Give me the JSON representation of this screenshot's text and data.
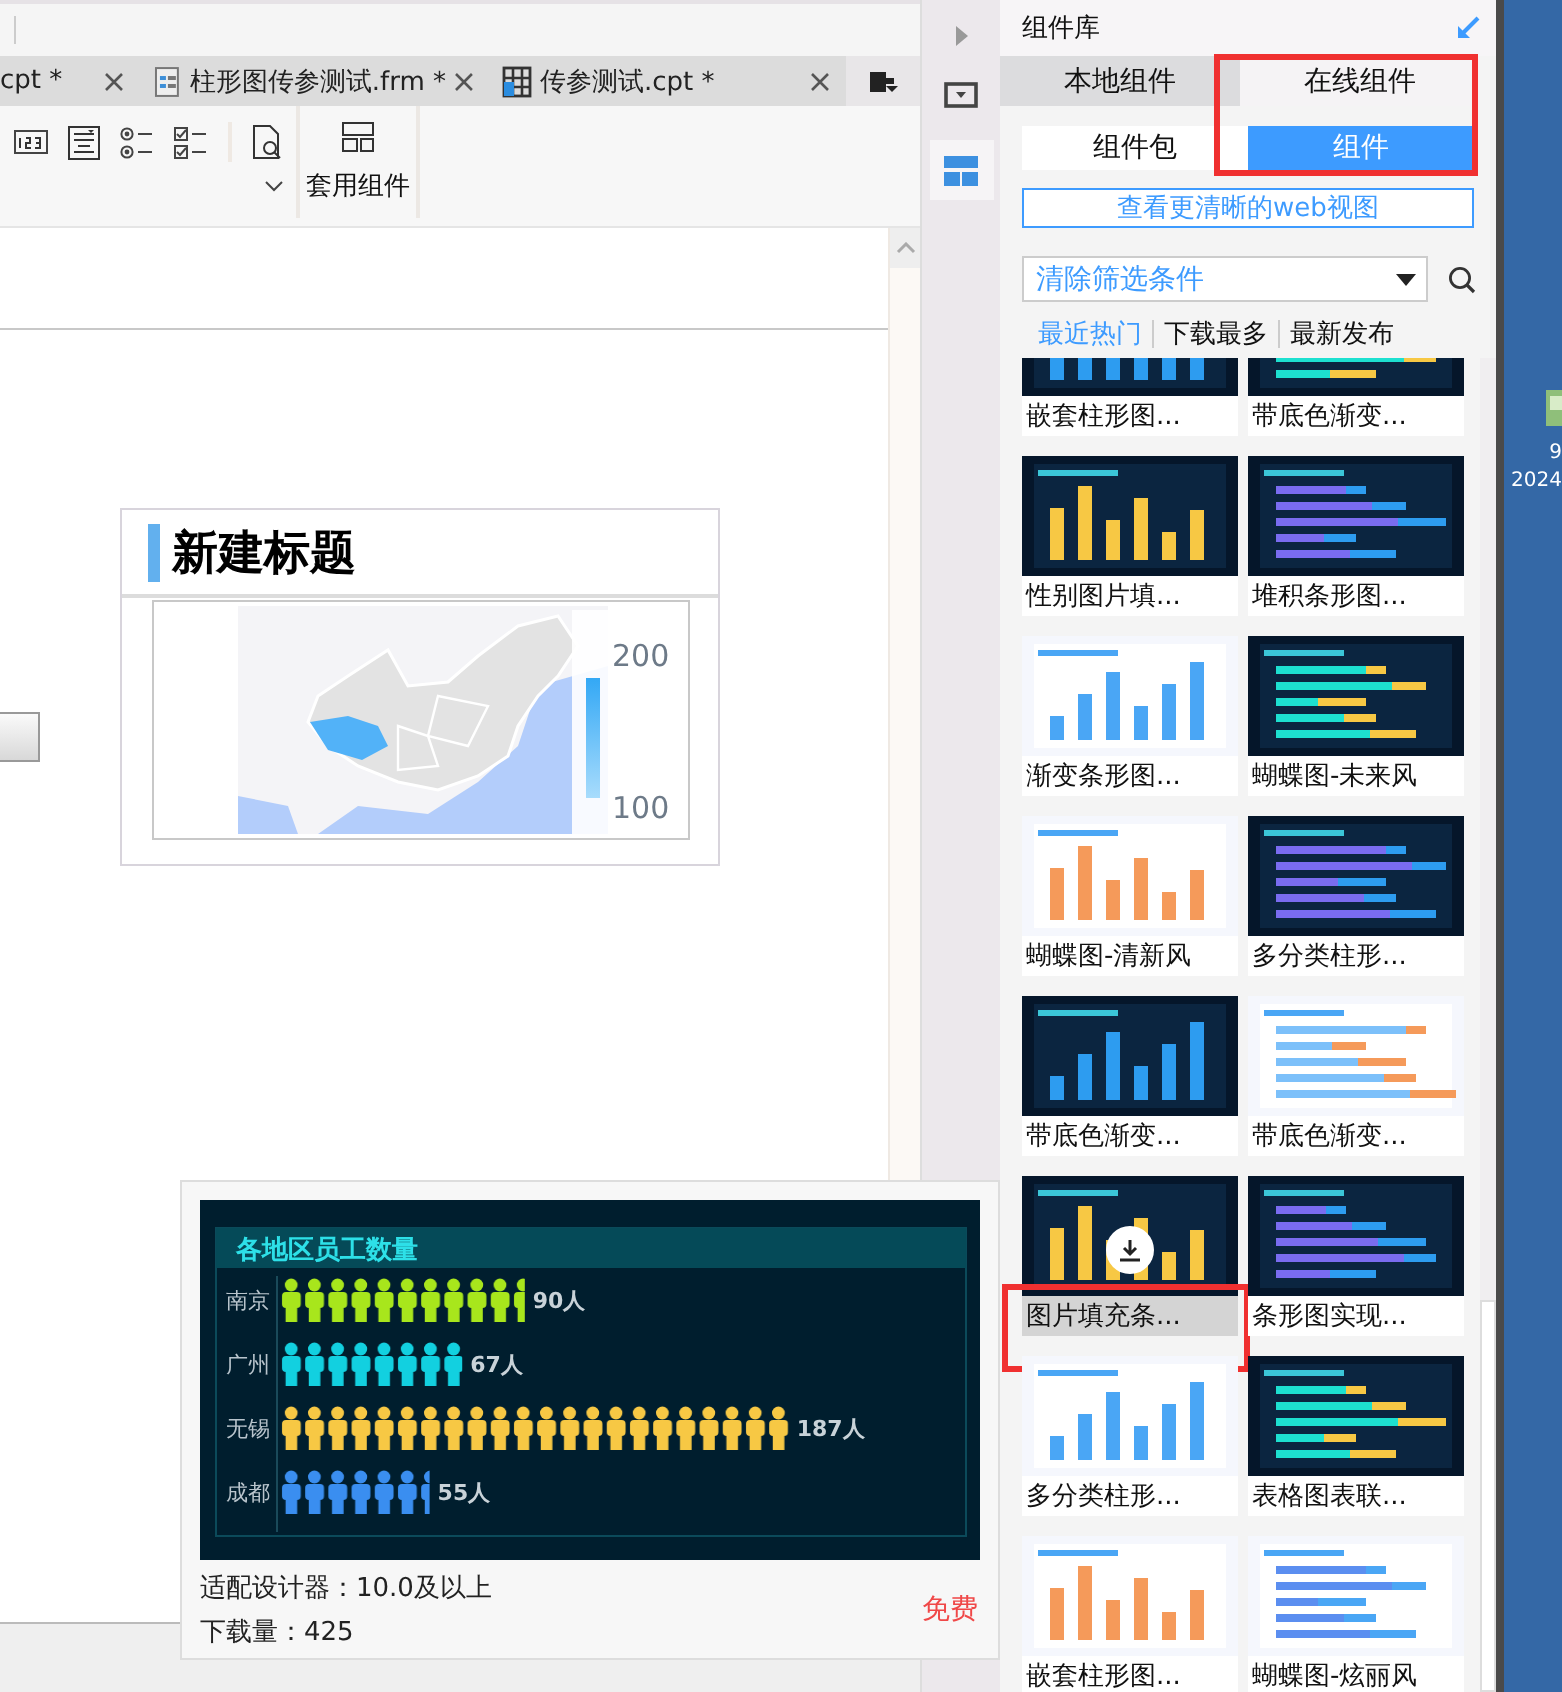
{
  "editor": {
    "tabs": [
      {
        "label": "cpt *",
        "kind": "plain",
        "selected": false
      },
      {
        "label": "柱形图传参测试.frm *",
        "kind": "form",
        "selected": false
      },
      {
        "label": "传参测试.cpt *",
        "kind": "report",
        "selected": false
      }
    ],
    "toolbar": {
      "group_label": "套用组件"
    },
    "canvas": {
      "widget": {
        "title": "新建标题",
        "legend_max": "200",
        "legend_min": "100"
      }
    }
  },
  "side_strip": {
    "items": [
      {
        "kind": "window",
        "selected": false
      },
      {
        "kind": "layout",
        "selected": true
      }
    ]
  },
  "panel": {
    "title": "组件库",
    "tabs": [
      {
        "label": "本地组件",
        "selected": false
      },
      {
        "label": "在线组件",
        "selected": true
      }
    ],
    "subtabs": [
      {
        "label": "组件包",
        "selected": false
      },
      {
        "label": "组件",
        "selected": true
      }
    ],
    "tabs_highlighted": true,
    "web_view_button": "查看更清晰的web视图",
    "filter": {
      "value": "清除筛选条件"
    },
    "sort_tabs": [
      {
        "label": "最近热门",
        "selected": true
      },
      {
        "label": "下载最多",
        "selected": false
      },
      {
        "label": "最新发布",
        "selected": false
      }
    ],
    "cards": [
      {
        "title": "嵌套柱形图...",
        "kind": "dark",
        "hovered": false,
        "highlighted": false
      },
      {
        "title": "带底色渐变...",
        "kind": "dark",
        "hovered": false,
        "highlighted": false
      },
      {
        "title": "性别图片填...",
        "kind": "dark",
        "hovered": false,
        "highlighted": false
      },
      {
        "title": "堆积条形图...",
        "kind": "dark",
        "hovered": false,
        "highlighted": false
      },
      {
        "title": "渐变条形图...",
        "kind": "light",
        "hovered": false,
        "highlighted": false
      },
      {
        "title": "蝴蝶图-未来风",
        "kind": "dark",
        "hovered": false,
        "highlighted": false
      },
      {
        "title": "蝴蝶图-清新风",
        "kind": "light",
        "hovered": false,
        "highlighted": false
      },
      {
        "title": "多分类柱形...",
        "kind": "dark",
        "hovered": false,
        "highlighted": false
      },
      {
        "title": "带底色渐变...",
        "kind": "dark",
        "hovered": false,
        "highlighted": false
      },
      {
        "title": "带底色渐变...",
        "kind": "light",
        "hovered": false,
        "highlighted": false
      },
      {
        "title": "图片填充条...",
        "kind": "dark",
        "hovered": true,
        "highlighted": true
      },
      {
        "title": "条形图实现...",
        "kind": "dark",
        "hovered": false,
        "highlighted": false
      },
      {
        "title": "多分类柱形...",
        "kind": "light",
        "hovered": false,
        "highlighted": false
      },
      {
        "title": "表格图表联...",
        "kind": "dark",
        "hovered": false,
        "highlighted": false
      },
      {
        "title": "嵌套柱形图...",
        "kind": "light",
        "hovered": false,
        "highlighted": false
      },
      {
        "title": "蝴蝶图-炫丽风",
        "kind": "light",
        "hovered": false,
        "highlighted": false
      }
    ]
  },
  "popup": {
    "preview": {
      "chart_data": {
        "type": "bar",
        "orientation": "horizontal",
        "title": "各地区员工数量",
        "categories": [
          "南京",
          "广州",
          "无锡",
          "成都"
        ],
        "values": [
          90,
          67,
          187,
          55
        ],
        "colors": [
          "#a8e61c",
          "#12d0e0",
          "#f7c844",
          "#3a8ef0"
        ],
        "value_labels": [
          "90人",
          "67人",
          "187人",
          "55人"
        ]
      }
    },
    "compat": "适配设计器：10.0及以上",
    "downloads": "下载量：425",
    "price": "免费"
  },
  "desktop": {
    "icon_label_lines": [
      "9",
      "2024"
    ]
  }
}
